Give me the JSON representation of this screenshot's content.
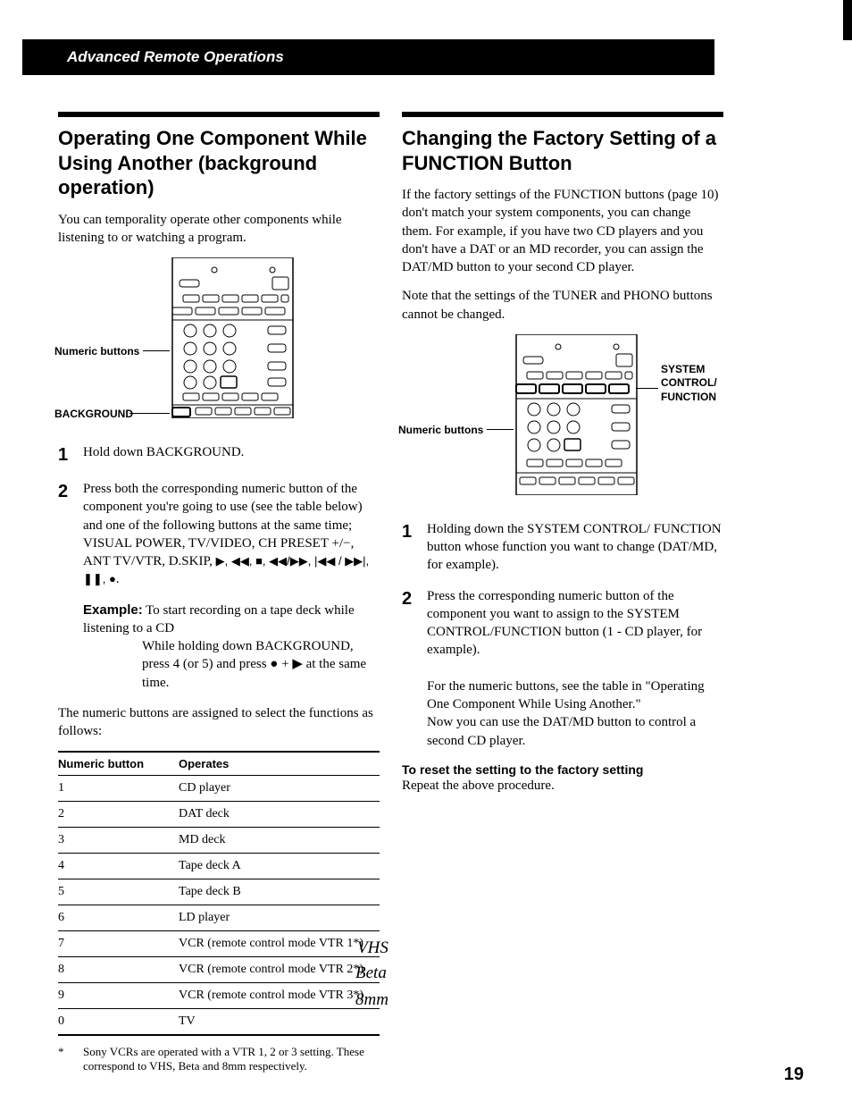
{
  "header": "Advanced Remote Operations",
  "left": {
    "title": "Operating One Component While Using Another (background operation)",
    "intro": "You can temporality operate other components while listening to or watching a program.",
    "callout1": "Numeric buttons",
    "callout2": "BACKGROUND",
    "step1": "Hold down BACKGROUND.",
    "step2a": "Press both the corresponding numeric button of the component you're going to use (see the table below) and one of the following buttons at the same time; VISUAL POWER, TV/VIDEO, CH PRESET +/−, ANT TV/VTR, D.SKIP, ",
    "step2icons": "▶, ◀◀, ■, ◀◀/▶▶, |◀◀ / ▶▶|, ❚❚, ●",
    "step2b": ".",
    "exampleLabel": "Example:",
    "exampleLine1": " To start recording on a tape deck while listening to a CD",
    "exampleLine2": "While holding down BACKGROUND, press 4 (or 5)  and press ● + ▶ at the same time.",
    "tableIntro": "The numeric buttons are assigned to select the functions as follows:",
    "th1": "Numeric button",
    "th2": "Operates",
    "rows": [
      {
        "n": "1",
        "op": "CD player"
      },
      {
        "n": "2",
        "op": "DAT deck"
      },
      {
        "n": "3",
        "op": "MD deck"
      },
      {
        "n": "4",
        "op": "Tape deck A"
      },
      {
        "n": "5",
        "op": "Tape deck B"
      },
      {
        "n": "6",
        "op": "LD player"
      },
      {
        "n": "7",
        "op": "VCR (remote control mode VTR 1*)"
      },
      {
        "n": "8",
        "op": "VCR (remote control mode VTR 2*)"
      },
      {
        "n": "9",
        "op": "VCR (remote control mode VTR 3*)"
      },
      {
        "n": "0",
        "op": "TV"
      }
    ],
    "footnote": "Sony VCRs are operated with a VTR 1, 2 or 3 setting. These correspond to VHS, Beta and 8mm respectively.",
    "hw1": "VHS",
    "hw2": "Beta",
    "hw3": "8mm"
  },
  "right": {
    "title": "Changing the Factory Setting of a FUNCTION Button",
    "p1": "If the factory settings of the FUNCTION buttons (page 10) don't match your system components, you can change them. For example, if you have two CD players and you don't have a DAT or an MD recorder, you can assign the DAT/MD button to your second CD player.",
    "p2": "Note that the settings of the TUNER and PHONO buttons cannot be changed.",
    "callout1": "Numeric buttons",
    "callout2a": "SYSTEM",
    "callout2b": "CONTROL/",
    "callout2c": "FUNCTION",
    "step1": "Holding down the SYSTEM CONTROL/ FUNCTION button whose function you want to change (DAT/MD, for example).",
    "step2": "Press the corresponding numeric button of the component you want to assign to the SYSTEM CONTROL/FUNCTION button (1 - CD player, for example).",
    "p3": "For the numeric buttons, see the table in \"Operating One Component While Using Another.\"",
    "p4": "Now you can use the DAT/MD button to control a second CD player.",
    "resetH": "To reset the setting to the factory setting",
    "resetP": "Repeat the above procedure."
  },
  "pageNum": "19"
}
